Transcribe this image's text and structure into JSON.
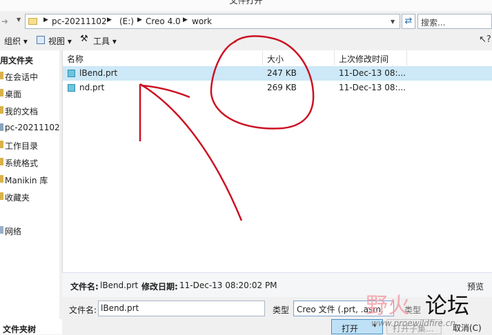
{
  "window": {
    "title": "文件打开"
  },
  "address": {
    "crumbs": [
      "pc-20211102",
      "(E:)",
      "Creo 4.0",
      "work"
    ]
  },
  "search": {
    "placeholder": "搜索..."
  },
  "toolbar": {
    "organize": "组织 ▾",
    "views": "视图 ▾",
    "tools": "工具 ▾"
  },
  "sidebar": {
    "header": "用文件夹",
    "items": [
      {
        "label": "在会话中"
      },
      {
        "label": "桌面"
      },
      {
        "label": "我的文档"
      },
      {
        "label": "pc-20211102"
      },
      {
        "label": "工作目录"
      },
      {
        "label": "系统格式"
      },
      {
        "label": "Manikin 库"
      },
      {
        "label": "收藏夹"
      },
      {
        "label": "网络"
      }
    ],
    "footer": "文件夹树"
  },
  "filelist": {
    "columns": {
      "name": "名称",
      "size": "大小",
      "modified": "上次修改时间"
    },
    "rows": [
      {
        "name": "lBend.prt",
        "size": "247 KB",
        "modified": "11-Dec-13 08:...",
        "selected": true
      },
      {
        "name": "nd.prt",
        "size": "269 KB",
        "modified": "11-Dec-13 08:...",
        "selected": false
      }
    ]
  },
  "details": {
    "name_label": "文件名:",
    "name_value": "lBend.prt",
    "date_label": "修改日期:",
    "date_value": "11-Dec-13 08:20:02 PM",
    "preview": "预览"
  },
  "form": {
    "filename_label": "文件名:",
    "filename_value": "lBend.prt",
    "type_label": "类型",
    "type_value": "Creo 文件 (.prt, .asm,",
    "type_label2": "类型",
    "open": "打开",
    "open_dropdown": "▾",
    "open_set": "打开子集...",
    "cancel": "取消(C)"
  },
  "watermark": {
    "text1": "野火",
    "text2": "论坛",
    "url": "www.proewildfire.cn"
  },
  "colors": {
    "selected_row": "#cde8f7",
    "annotation": "#cc1122",
    "primary_button": "#bfe1f7"
  },
  "icons": {
    "back": "back-arrow-icon",
    "refresh": "refresh-icon",
    "folder": "folder-icon",
    "file": "part-file-icon",
    "help": "help-cursor-icon"
  }
}
